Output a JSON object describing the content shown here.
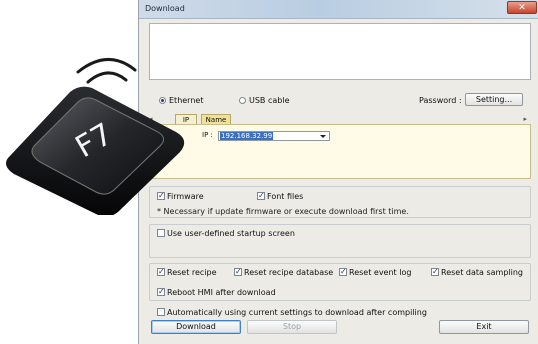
{
  "window": {
    "title": "Download",
    "close_glyph": "✕"
  },
  "connection": {
    "ethernet_label": "Ethernet",
    "usb_label": "USB cable",
    "selected": "ethernet",
    "password_label": "Password :",
    "setting_button": "Setting..."
  },
  "target_tabs": {
    "left_arrow": "◂",
    "right_arrow": "▸",
    "items": [
      {
        "label": "IP",
        "active": false
      },
      {
        "label": "Name",
        "active": true
      }
    ]
  },
  "ip": {
    "label": "IP :",
    "value": "192.168.32.99"
  },
  "options": {
    "firmware_label": "Firmware",
    "firmware_checked": true,
    "font_files_label": "Font files",
    "font_files_checked": true,
    "note": "* Necessary if update firmware or execute download first time.",
    "startup_label": "Use user-defined startup screen",
    "startup_checked": false
  },
  "reset": {
    "recipe_label": "Reset recipe",
    "recipe_db_label": "Reset recipe database",
    "event_log_label": "Reset event log",
    "data_sampling_label": "Reset data sampling",
    "reboot_label": "Reboot HMI after download",
    "all_checked": true
  },
  "auto": {
    "label": "Automatically using current settings to download after compiling",
    "checked": false
  },
  "buttons": {
    "download": "Download",
    "stop": "Stop",
    "exit": "Exit"
  },
  "keycap": {
    "label": "F7"
  },
  "colors": {
    "accent": "#3a6fc4",
    "tab_active": "#f0e199",
    "panel": "#fffbe6"
  }
}
